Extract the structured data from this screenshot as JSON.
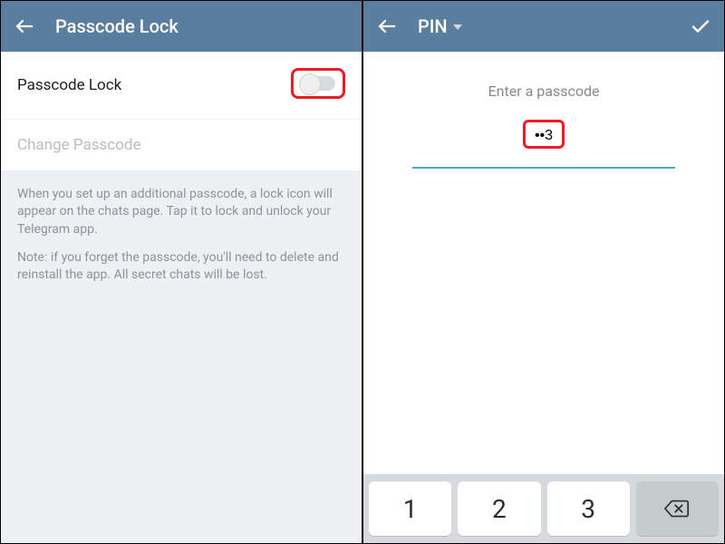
{
  "colors": {
    "header_bg": "#5a7e9e",
    "accent": "#4ea2cf",
    "highlight": "#ec1c24"
  },
  "left": {
    "header_title": "Passcode Lock",
    "row_passcode_lock": "Passcode Lock",
    "row_change_passcode": "Change Passcode",
    "help_p1": "When you set up an additional passcode, a lock icon will appear on the chats page. Tap it to lock and unlock your Telegram app.",
    "help_p2": "Note: if you forget the passcode, you'll need to delete and reinstall the app. All secret chats will be lost."
  },
  "right": {
    "header_type_label": "PIN",
    "enter_label": "Enter a passcode",
    "pin_display": "••3",
    "keypad": {
      "k1": "1",
      "k2": "2",
      "k3": "3"
    }
  }
}
